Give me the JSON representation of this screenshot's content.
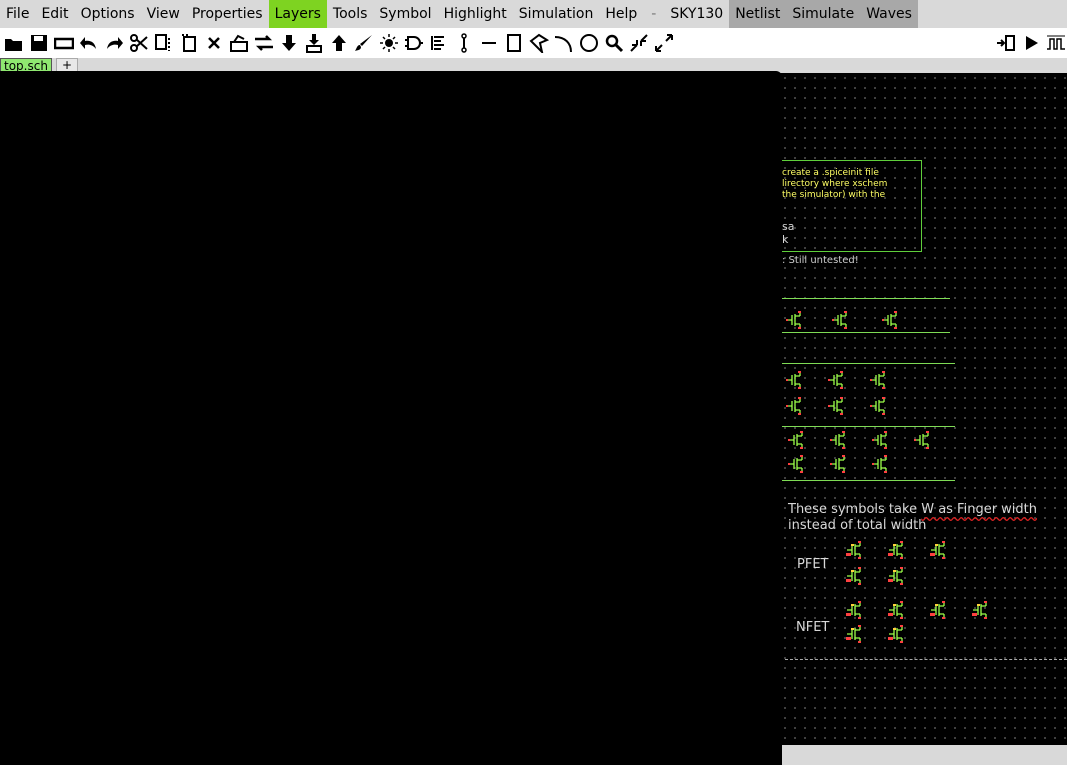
{
  "menu": {
    "items": [
      "File",
      "Edit",
      "Options",
      "View",
      "Properties",
      "Layers",
      "Tools",
      "Symbol",
      "Highlight",
      "Simulation",
      "Help"
    ],
    "active": "Layers",
    "separator": "-",
    "pdk": "SKY130",
    "sim_items": [
      "Netlist",
      "Simulate",
      "Waves"
    ]
  },
  "toolbar": {
    "icons": [
      "open-icon",
      "save-icon",
      "reload-icon",
      "undo-icon",
      "redo-icon",
      "cut-icon",
      "copy-icon",
      "paste-icon",
      "delete-icon",
      "insert-symbol-icon",
      "swap-icon",
      "push-down-icon",
      "push-down-sym-icon",
      "pop-up-icon",
      "brush-icon",
      "highlight-icon",
      "gate-icon",
      "align-icon",
      "pin-icon",
      "line-icon",
      "rect-icon",
      "polygon-icon",
      "arc-icon",
      "circle-icon",
      "zoom-icon",
      "zoom-out-icon",
      "zoom-fit-icon"
    ],
    "right_icons": [
      "netlist-go-icon",
      "play-icon",
      "waveform-icon"
    ]
  },
  "tabs": {
    "current": "top.sch",
    "add": "+"
  },
  "schematic": {
    "note_lines": [
      "create a .spiceinit file",
      "lirectory where xschem",
      "the simulator) with the",
      "",
      "sa",
      "k"
    ],
    "untested": ": Still untested!",
    "finger_note_1": "These symbols take W as Finger width",
    "finger_note_2": "instead of total width",
    "pfet_label": "PFET",
    "nfet_label": "NFET"
  },
  "colors": {
    "accent": "#7ed321",
    "wire": "#7fdc55",
    "text": "#ffff66",
    "canvas": "#000000"
  }
}
